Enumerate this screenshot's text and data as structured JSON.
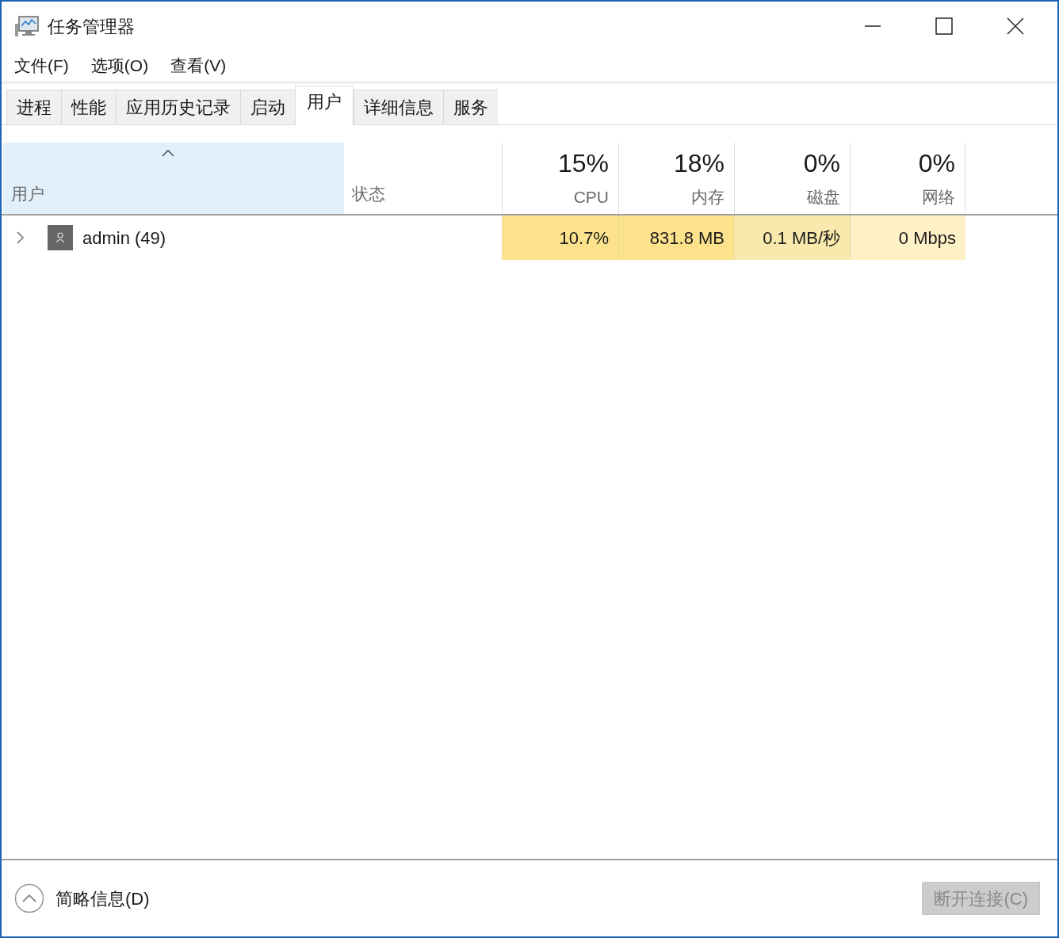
{
  "window": {
    "title": "任务管理器"
  },
  "menu": [
    "文件(F)",
    "选项(O)",
    "查看(V)"
  ],
  "tabs": [
    {
      "label": "进程",
      "selected": false
    },
    {
      "label": "性能",
      "selected": false
    },
    {
      "label": "应用历史记录",
      "selected": false
    },
    {
      "label": "启动",
      "selected": false
    },
    {
      "label": "用户",
      "selected": true
    },
    {
      "label": "详细信息",
      "selected": false
    },
    {
      "label": "服务",
      "selected": false
    }
  ],
  "columns": [
    {
      "kind": "text",
      "label": "用户",
      "sorted": true
    },
    {
      "kind": "text",
      "label": "状态",
      "sorted": false
    },
    {
      "kind": "metric",
      "total": "15%",
      "label": "CPU",
      "sorted": false
    },
    {
      "kind": "metric",
      "total": "18%",
      "label": "内存",
      "sorted": false
    },
    {
      "kind": "metric",
      "total": "0%",
      "label": "磁盘",
      "sorted": false
    },
    {
      "kind": "metric",
      "total": "0%",
      "label": "网络",
      "sorted": false
    }
  ],
  "rows": [
    {
      "name": "admin (49)",
      "expanded": false,
      "metrics": [
        {
          "value": "10.7%",
          "color": "#fde28c"
        },
        {
          "value": "831.8 MB",
          "color": "#fde28c"
        },
        {
          "value": "0.1 MB/秒",
          "color": "#f9e9ad"
        },
        {
          "value": "0 Mbps",
          "color": "#fff1c6"
        }
      ]
    }
  ],
  "footer": {
    "details_toggle": "简略信息(D)",
    "disconnect_button": {
      "label": "断开连接(C)",
      "disabled": true
    }
  }
}
